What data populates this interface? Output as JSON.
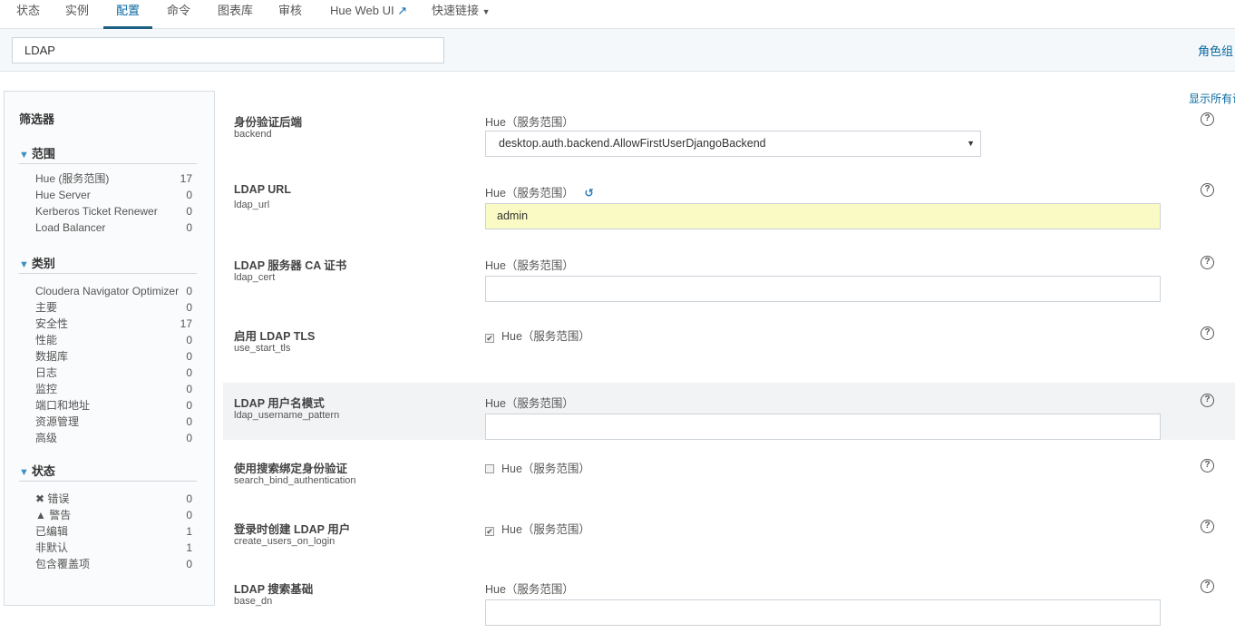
{
  "nav": {
    "tabs": [
      {
        "label": "状态"
      },
      {
        "label": "实例"
      },
      {
        "label": "配置",
        "active": true
      },
      {
        "label": "命令"
      },
      {
        "label": "图表库"
      },
      {
        "label": "审核"
      },
      {
        "label": "Hue Web UI"
      },
      {
        "label": "快速链接"
      }
    ]
  },
  "filterbar": {
    "search_value": "LDAP",
    "role_group": "角色组",
    "show_all": "显示所有说明"
  },
  "sidebar": {
    "title": "筛选器",
    "scope": {
      "title": "范围",
      "items": [
        {
          "label": "Hue (服务范围)",
          "count": "17"
        },
        {
          "label": "Hue Server",
          "count": "0"
        },
        {
          "label": "Kerberos Ticket Renewer",
          "count": "0"
        },
        {
          "label": "Load Balancer",
          "count": "0"
        }
      ]
    },
    "category": {
      "title": "类别",
      "items": [
        {
          "label": "Cloudera Navigator Optimizer",
          "count": "0"
        },
        {
          "label": "主要",
          "count": "0"
        },
        {
          "label": "安全性",
          "count": "17"
        },
        {
          "label": "性能",
          "count": "0"
        },
        {
          "label": "数据库",
          "count": "0"
        },
        {
          "label": "日志",
          "count": "0"
        },
        {
          "label": "监控",
          "count": "0"
        },
        {
          "label": "端口和地址",
          "count": "0"
        },
        {
          "label": "资源管理",
          "count": "0"
        },
        {
          "label": "高级",
          "count": "0"
        }
      ]
    },
    "status": {
      "title": "状态",
      "items": [
        {
          "label": "错误",
          "count": "0",
          "icon": "error-icon"
        },
        {
          "label": "警告",
          "count": "0",
          "icon": "warning-icon"
        },
        {
          "label": "已编辑",
          "count": "1"
        },
        {
          "label": "非默认",
          "count": "1"
        },
        {
          "label": "包含覆盖项",
          "count": "0"
        }
      ]
    }
  },
  "settings": [
    {
      "label": "身份验证后端",
      "key": "backend",
      "scope": "Hue（服务范围）",
      "type": "select",
      "value": "desktop.auth.backend.AllowFirstUserDjangoBackend"
    },
    {
      "label": "LDAP URL",
      "key": "ldap_url",
      "scope": "Hue（服务范围）",
      "type": "text",
      "value": "admin",
      "edited": true
    },
    {
      "label": "LDAP 服务器 CA 证书",
      "key": "ldap_cert",
      "scope": "Hue（服务范围）",
      "type": "text",
      "value": ""
    },
    {
      "label": "启用 LDAP TLS",
      "key": "use_start_tls",
      "scope": "Hue（服务范围）",
      "type": "checkbox",
      "checked": true
    },
    {
      "label": "LDAP 用户名模式",
      "key": "ldap_username_pattern",
      "scope": "Hue（服务范围）",
      "type": "text",
      "value": ""
    },
    {
      "label": "使用搜索绑定身份验证",
      "key": "search_bind_authentication",
      "scope": "Hue（服务范围）",
      "type": "checkbox",
      "checked": false
    },
    {
      "label": "登录时创建 LDAP 用户",
      "key": "create_users_on_login",
      "scope": "Hue（服务范围）",
      "type": "checkbox",
      "checked": true
    },
    {
      "label": "LDAP 搜索基础",
      "key": "base_dn",
      "scope": "Hue（服务范围）",
      "type": "text",
      "value": ""
    }
  ]
}
